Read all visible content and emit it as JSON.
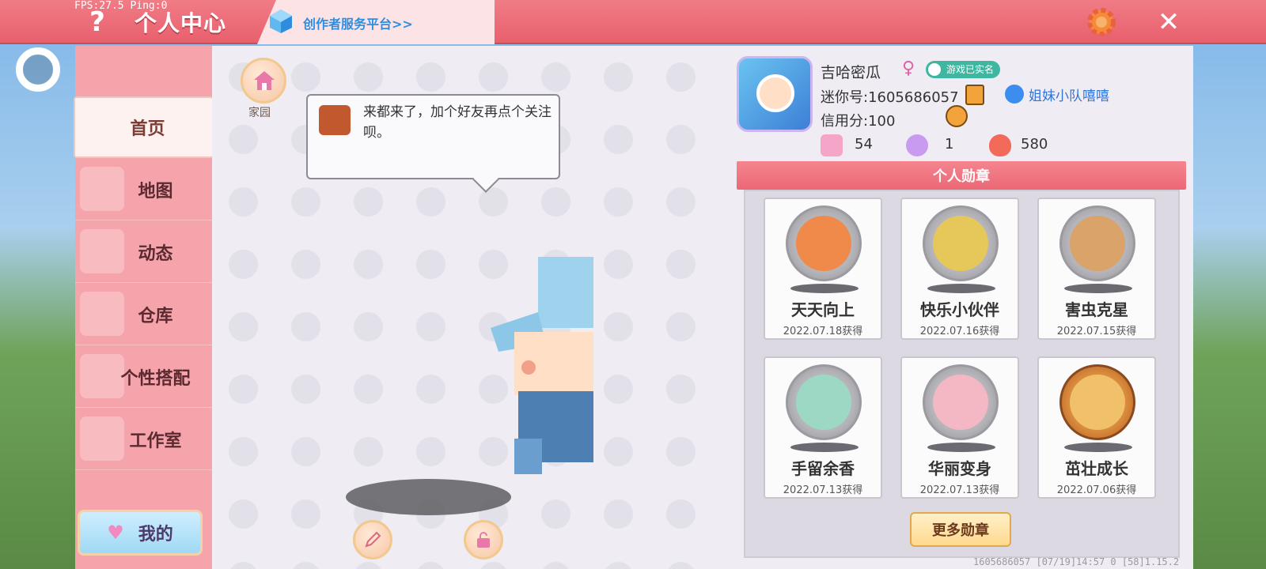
{
  "topbar": {
    "fps_text": "FPS:27.5  Ping:0",
    "help_label": "?",
    "title": "个人中心",
    "creator_link": "创作者服务平台>>",
    "close_label": "✕"
  },
  "sidebar": {
    "items": [
      {
        "label": "首页"
      },
      {
        "label": "地图"
      },
      {
        "label": "动态"
      },
      {
        "label": "仓库"
      },
      {
        "label": "个性搭配"
      },
      {
        "label": "工作室"
      }
    ],
    "mine_label": "我的"
  },
  "center": {
    "home_label": "家园",
    "bubble_text": "来都来了，加个好友再点个关注呗。"
  },
  "profile": {
    "nickname": "吉哈密瓜",
    "gender_symbol": "♀",
    "verified_label": "游戏已实名",
    "mini_id": "迷你号:1605686057",
    "team_name": "姐妹小队嘻嘻",
    "credit": "信用分:100",
    "stats": [
      {
        "icon": "gift-icon",
        "value": "54"
      },
      {
        "icon": "cheer-icon",
        "value": "1"
      },
      {
        "icon": "flame-icon",
        "value": "580"
      }
    ]
  },
  "medals": {
    "header": "个人勋章",
    "items": [
      {
        "name": "天天向上",
        "date": "2022.07.18获得"
      },
      {
        "name": "快乐小伙伴",
        "date": "2022.07.16获得"
      },
      {
        "name": "害虫克星",
        "date": "2022.07.15获得"
      },
      {
        "name": "手留余香",
        "date": "2022.07.13获得"
      },
      {
        "name": "华丽变身",
        "date": "2022.07.13获得"
      },
      {
        "name": "茁壮成长",
        "date": "2022.07.06获得"
      }
    ],
    "more_label": "更多勋章"
  },
  "footer": {
    "info": "1605686057   [07/19]14:57 0  [58]1.15.2"
  },
  "colors": {
    "topbar": "#e8606d",
    "sidebar": "#f6a4ab",
    "accent_link": "#2f8de0",
    "verified": "#3fb6a0"
  }
}
